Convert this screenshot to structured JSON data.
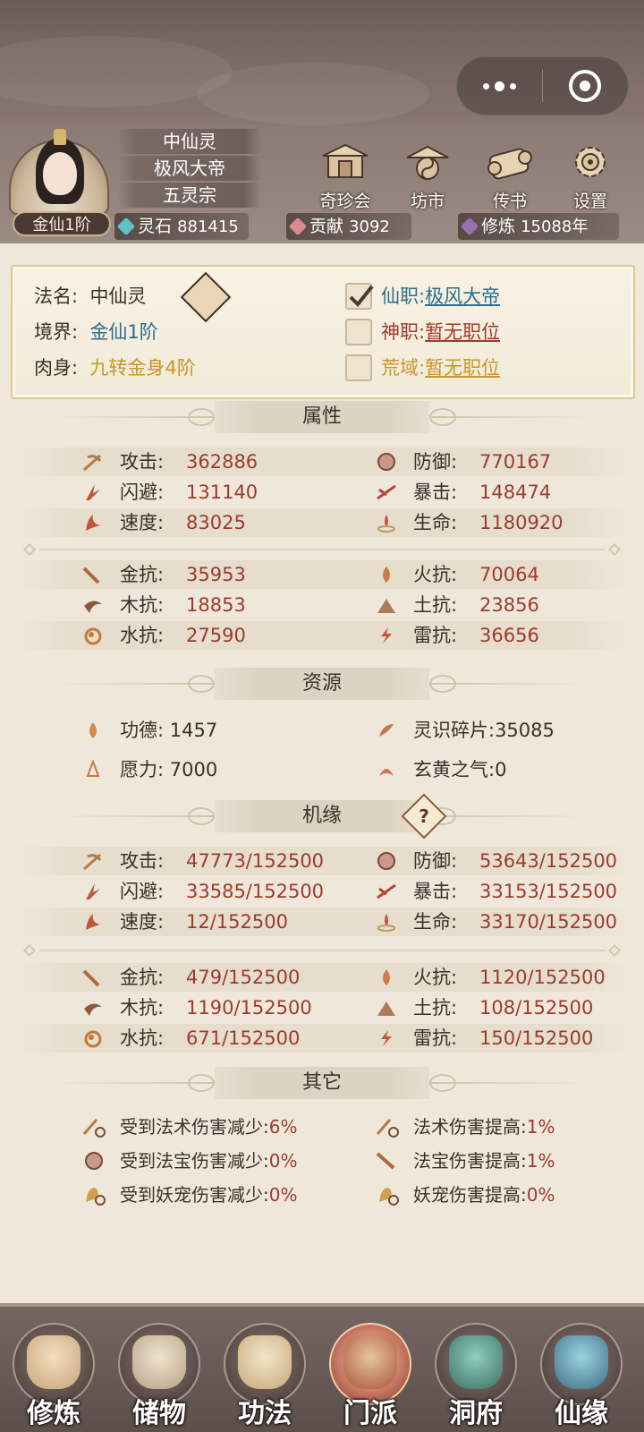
{
  "top_capsule": {
    "more_icon": "more-dots-icon",
    "close_icon": "target-circle-icon"
  },
  "header": {
    "name": "中仙灵",
    "title": "极风大帝",
    "sect": "五灵宗",
    "rank": "金仙1阶",
    "buttons": [
      {
        "label": "奇珍会",
        "icon": "treasure-pavilion-icon"
      },
      {
        "label": "坊市",
        "icon": "market-icon"
      },
      {
        "label": "传书",
        "icon": "scroll-mail-icon"
      },
      {
        "label": "设置",
        "icon": "gear-icon"
      }
    ],
    "resources": {
      "spirit_stone": {
        "label": "灵石",
        "value": "881415",
        "color": "#5fc2c8"
      },
      "contribution": {
        "label": "贡献",
        "value": "3092",
        "color": "#d98c8c"
      },
      "cultivation": {
        "label": "修炼",
        "value": "15088年",
        "color": "#9a6fb0"
      }
    }
  },
  "profile": {
    "name_label": "法名:",
    "name_value": "中仙灵",
    "realm_label": "境界:",
    "realm_value": "金仙1阶",
    "body_label": "肉身:",
    "body_value": "九转金身4阶",
    "xianzhi_label": "仙职:",
    "xianzhi_value": "极风大帝",
    "xianzhi_checked": true,
    "shenzhi_label": "神职:",
    "shenzhi_value": "暂无职位",
    "huangyu_label": "荒域:",
    "huangyu_value": "暂无职位"
  },
  "sections": {
    "attributes": "属性",
    "resources": "资源",
    "fortune": "机缘",
    "others": "其它"
  },
  "attributes": {
    "main": [
      {
        "left_label": "攻击:",
        "left_value": "362886",
        "left_icon": "attack-icon",
        "right_label": "防御:",
        "right_value": "770167",
        "right_icon": "defense-icon"
      },
      {
        "left_label": "闪避:",
        "left_value": "131140",
        "left_icon": "dodge-icon",
        "right_label": "暴击:",
        "right_value": "148474",
        "right_icon": "crit-icon"
      },
      {
        "left_label": "速度:",
        "left_value": "83025",
        "left_icon": "speed-icon",
        "right_label": "生命:",
        "right_value": "1180920",
        "right_icon": "life-icon"
      }
    ],
    "resist": [
      {
        "left_label": "金抗:",
        "left_value": "35953",
        "left_icon": "metal-resist-icon",
        "right_label": "火抗:",
        "right_value": "70064",
        "right_icon": "fire-resist-icon"
      },
      {
        "left_label": "木抗:",
        "left_value": "18853",
        "left_icon": "wood-resist-icon",
        "right_label": "土抗:",
        "right_value": "23856",
        "right_icon": "earth-resist-icon"
      },
      {
        "left_label": "水抗:",
        "left_value": "27590",
        "left_icon": "water-resist-icon",
        "right_label": "雷抗:",
        "right_value": "36656",
        "right_icon": "thunder-resist-icon"
      }
    ]
  },
  "resources_list": [
    {
      "left": "功德:  1457",
      "left_icon": "merit-flame-icon",
      "right": "灵识碎片:35085",
      "right_icon": "spirit-shard-icon"
    },
    {
      "left": "愿力:  7000",
      "left_icon": "wish-power-icon",
      "right": "玄黄之气:0",
      "right_icon": "xuanhuang-qi-icon"
    }
  ],
  "fortune": {
    "help_label": "?",
    "main": [
      {
        "left_label": "攻击:",
        "left_value": "47773/152500",
        "right_label": "防御:",
        "right_value": "53643/152500"
      },
      {
        "left_label": "闪避:",
        "left_value": "33585/152500",
        "right_label": "暴击:",
        "right_value": "33153/152500"
      },
      {
        "left_label": "速度:",
        "left_value": "12/152500",
        "right_label": "生命:",
        "right_value": "33170/152500"
      }
    ],
    "resist": [
      {
        "left_label": "金抗:",
        "left_value": "479/152500",
        "right_label": "火抗:",
        "right_value": "1120/152500"
      },
      {
        "left_label": "木抗:",
        "left_value": "1190/152500",
        "right_label": "土抗:",
        "right_value": "108/152500"
      },
      {
        "left_label": "水抗:",
        "left_value": "671/152500",
        "right_label": "雷抗:",
        "right_value": "150/152500"
      }
    ]
  },
  "others": [
    {
      "left_label": "受到法术伤害减少:",
      "left_value": "6%",
      "right_label": "法术伤害提高:",
      "right_value": "1%"
    },
    {
      "left_label": "受到法宝伤害减少:",
      "left_value": "0%",
      "right_label": "法宝伤害提高:",
      "right_value": "1%"
    },
    {
      "left_label": "受到妖宠伤害减少:",
      "left_value": "0%",
      "right_label": "妖宠伤害提高:",
      "right_value": "0%"
    }
  ],
  "bottom_nav": [
    {
      "label": "修炼",
      "icon": "meditation-icon",
      "active": false
    },
    {
      "label": "储物",
      "icon": "storage-bag-icon",
      "active": false
    },
    {
      "label": "功法",
      "icon": "technique-scroll-icon",
      "active": false
    },
    {
      "label": "门派",
      "icon": "sect-gate-icon",
      "active": true
    },
    {
      "label": "洞府",
      "icon": "cave-mansion-icon",
      "active": false
    },
    {
      "label": "仙缘",
      "icon": "immortal-fate-icon",
      "active": false
    }
  ],
  "colors": {
    "value_red": "#9b3b2e",
    "link_blue": "#2d6d8c",
    "gold": "#c8962a",
    "card_border": "#e5c58e"
  }
}
